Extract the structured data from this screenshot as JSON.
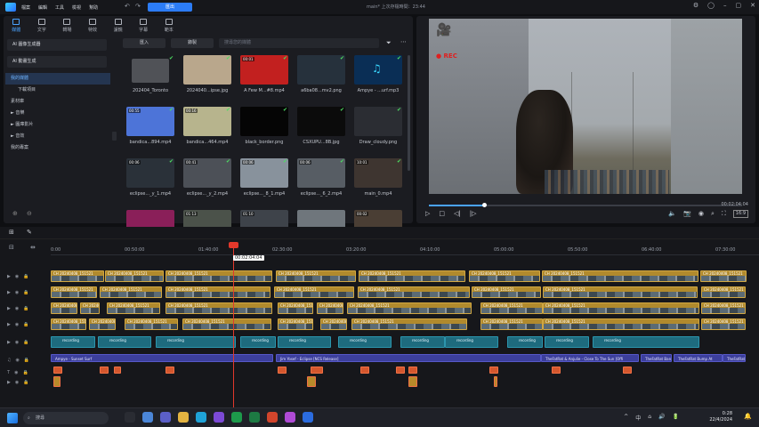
{
  "titlebar": {
    "menu": [
      "檔案",
      "編輯",
      "工具",
      "檢視",
      "幫助"
    ],
    "export_label": "匯出",
    "doc_name": "main* 上次存檔時間：23:44"
  },
  "tabs": [
    {
      "label": "媒體",
      "icon": "media-icon"
    },
    {
      "label": "文字",
      "icon": "text-icon"
    },
    {
      "label": "轉場",
      "icon": "transition-icon"
    },
    {
      "label": "特效",
      "icon": "effects-icon"
    },
    {
      "label": "濾鏡",
      "icon": "filter-icon"
    },
    {
      "label": "字幕",
      "icon": "subtitle-icon"
    },
    {
      "label": "範本",
      "icon": "template-icon"
    }
  ],
  "sidenav": {
    "ai_items": [
      "AI 圖像生成器",
      "AI 動畫生成"
    ],
    "items": [
      {
        "label": "我的媒體",
        "type": "sel"
      },
      {
        "label": "下載項目",
        "type": "sub"
      },
      {
        "label": "素材庫",
        "type": "normal"
      },
      {
        "label": "► 音樂",
        "type": "normal"
      },
      {
        "label": "► 圖庫影片",
        "type": "normal"
      },
      {
        "label": "► 音效",
        "type": "normal"
      },
      {
        "label": "我的專案",
        "type": "normal"
      }
    ]
  },
  "media_toolbar": {
    "import_label": "匯入",
    "record_label": "錄製",
    "search_placeholder": "搜尋您的媒體"
  },
  "media": [
    {
      "label": "202404_Toronto",
      "kind": "folder",
      "badge": "",
      "color": "#505257"
    },
    {
      "label": "2024040...ipse.jpg",
      "kind": "image",
      "badge": "",
      "color": "#b9a78c"
    },
    {
      "label": "A Few M...#8.mp4",
      "kind": "video",
      "badge": "00:01",
      "color": "#c2201f"
    },
    {
      "label": "a6ba08...mv2.png",
      "kind": "image",
      "badge": "",
      "color": "#26313c"
    },
    {
      "label": "Ampye - ...urf.mp3",
      "kind": "audio",
      "badge": "",
      "color": "#0a2e55"
    },
    {
      "label": "bandica...894.mp4",
      "kind": "video",
      "badge": "00:55",
      "color": "#4d74d8"
    },
    {
      "label": "bandica...464.mp4",
      "kind": "video",
      "badge": "00:16",
      "color": "#b7b48d"
    },
    {
      "label": "black_border.png",
      "kind": "image",
      "badge": "",
      "color": "#050505"
    },
    {
      "label": "CSXUPU...8B.jpg",
      "kind": "image",
      "badge": "",
      "color": "#0b0b0b"
    },
    {
      "label": "Draw_cloudy.png",
      "kind": "image",
      "badge": "",
      "color": "#2b2d33"
    },
    {
      "label": "eclipse..._y_1.mp4",
      "kind": "video",
      "badge": "00:06",
      "color": "#2a3139"
    },
    {
      "label": "eclipse..._y_2.mp4",
      "kind": "video",
      "badge": "00:41",
      "color": "#4c5057"
    },
    {
      "label": "eclipse..._8_1.mp4",
      "kind": "video",
      "badge": "00:06",
      "color": "#88929c"
    },
    {
      "label": "eclipse..._6_2.mp4",
      "kind": "video",
      "badge": "00:06",
      "color": "#575d64"
    },
    {
      "label": "main_0.mp4",
      "kind": "video",
      "badge": "10:01",
      "color": "#3e3530"
    },
    {
      "label": "",
      "kind": "video",
      "badge": "",
      "color": "#8a1f59"
    },
    {
      "label": "",
      "kind": "video",
      "badge": "01:13",
      "color": "#4b524a"
    },
    {
      "label": "",
      "kind": "video",
      "badge": "01:10",
      "color": "#3e434a"
    },
    {
      "label": "",
      "kind": "video",
      "badge": "",
      "color": "#6f767c"
    },
    {
      "label": "",
      "kind": "video",
      "badge": "00:02",
      "color": "#4a3e34"
    }
  ],
  "preview": {
    "time": "00:02:04:04",
    "ratio": "16:9",
    "rec_label": "REC",
    "progress": 0.175
  },
  "timeline": {
    "ruler": [
      "0:00",
      "00:50:00",
      "01:40:00",
      "02:30:00",
      "03:20:00",
      "04:10:00",
      "05:00:00",
      "05:50:00",
      "06:40:00",
      "07:30:00"
    ],
    "playhead_time": "00:02:04:04",
    "clip_prefix": "CH 20240408_151521",
    "audio_tracks": [
      {
        "label": "Ampye - Sunset Surf"
      },
      {
        "label": "Jim Yosef - Eclipse [NCS Release]"
      },
      {
        "label": "TheFatRat & Anjulie - Close To The Sun [Offi"
      },
      {
        "label": "TheFatRat Ban"
      },
      {
        "label": "TheFatRat Bump At"
      },
      {
        "label": "TheFatRat Bu"
      }
    ],
    "rec_label": "recording"
  },
  "taskbar": {
    "search_label": "搜尋",
    "time": "0:28",
    "date": "22/4/2024",
    "tray": [
      "^",
      "中",
      "⌂",
      "🔊",
      "🔋"
    ]
  }
}
